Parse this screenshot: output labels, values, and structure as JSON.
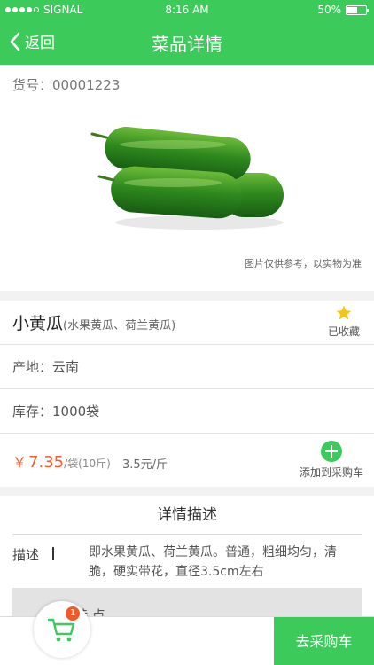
{
  "status_bar": {
    "carrier": "SIGNAL",
    "time": "8:16 AM",
    "battery": "50%",
    "battery_level": 0.5
  },
  "nav": {
    "back_label": "返回",
    "title": "菜品详情"
  },
  "product": {
    "sku_label": "货号：",
    "sku": "00001223",
    "image_note": "图片仅供参考，以实物为准",
    "name": "小黄瓜",
    "alias": "(水果黄瓜、荷兰黄瓜)",
    "favorite_label": "已收藏",
    "origin": "产地：云南",
    "stock": "库存：1000袋",
    "price_symbol": "￥",
    "price": "7.35",
    "price_unit": "/袋(10斤)",
    "unit_price": "3.5元/斤",
    "add_to_cart_label": "添加到采购车"
  },
  "details": {
    "title": "详情描述",
    "desc_label": "描述",
    "desc_text": "即水果黄瓜、荷兰黄瓜。普通，粗细均匀，清脆，硬实带花，直径3.5cm左右",
    "feature_label": "特 点"
  },
  "bottom_bar": {
    "cart_count": "1",
    "checkout_label": "去采购车"
  },
  "colors": {
    "accent": "#3ccb5a",
    "price": "#ff5a2a",
    "badge": "#f05a28",
    "star": "#f5c518"
  }
}
